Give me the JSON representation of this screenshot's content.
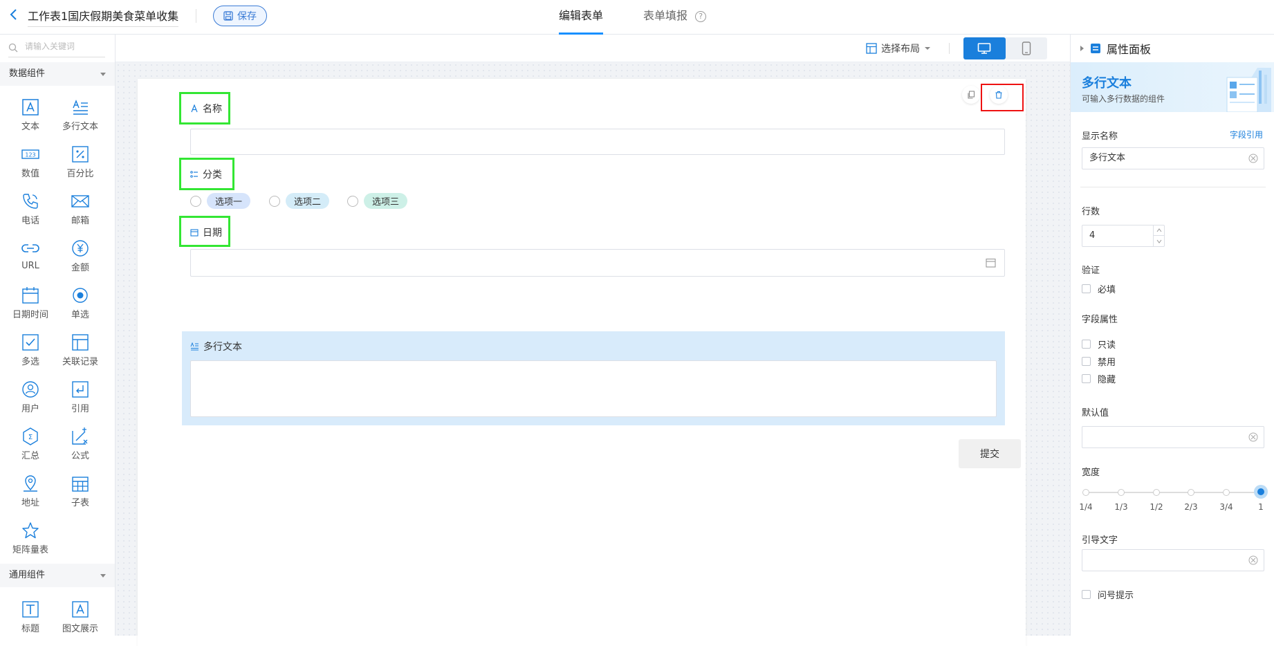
{
  "header": {
    "title": "工作表1国庆假期美食菜单收集",
    "save_label": "保存",
    "tabs": [
      {
        "label": "编辑表单",
        "active": true
      },
      {
        "label": "表单填报",
        "active": false
      }
    ],
    "help_icon": "question-circle-icon"
  },
  "sidebar": {
    "search_placeholder": "请输入关键词",
    "groups": [
      {
        "title": "数据组件",
        "items": [
          {
            "label": "文本",
            "icon": "text-icon"
          },
          {
            "label": "多行文本",
            "icon": "multiline-text-icon"
          },
          {
            "label": "数值",
            "icon": "number-icon"
          },
          {
            "label": "百分比",
            "icon": "percent-icon"
          },
          {
            "label": "电话",
            "icon": "phone-icon"
          },
          {
            "label": "邮箱",
            "icon": "mail-icon"
          },
          {
            "label": "URL",
            "icon": "link-icon"
          },
          {
            "label": "金额",
            "icon": "currency-icon"
          },
          {
            "label": "日期时间",
            "icon": "calendar-icon"
          },
          {
            "label": "单选",
            "icon": "radio-icon"
          },
          {
            "label": "多选",
            "icon": "checkbox-icon"
          },
          {
            "label": "关联记录",
            "icon": "relation-icon"
          },
          {
            "label": "用户",
            "icon": "user-icon"
          },
          {
            "label": "引用",
            "icon": "reference-icon"
          },
          {
            "label": "汇总",
            "icon": "sum-icon"
          },
          {
            "label": "公式",
            "icon": "formula-icon"
          },
          {
            "label": "地址",
            "icon": "location-icon"
          },
          {
            "label": "子表",
            "icon": "subtable-icon"
          },
          {
            "label": "矩阵量表",
            "icon": "star-icon"
          }
        ]
      },
      {
        "title": "通用组件",
        "items": [
          {
            "label": "标题",
            "icon": "heading-icon"
          },
          {
            "label": "图文展示",
            "icon": "rich-text-icon"
          }
        ]
      }
    ]
  },
  "toolbar": {
    "layout_label": "选择布局"
  },
  "form": {
    "fields": [
      {
        "label": "名称",
        "icon": "text-icon"
      },
      {
        "label": "分类",
        "icon": "list-icon"
      },
      {
        "label": "日期",
        "icon": "calendar-icon"
      },
      {
        "label": "多行文本",
        "icon": "multiline-text-icon"
      }
    ],
    "options": [
      {
        "label": "选项一",
        "color": "#d6e4fb"
      },
      {
        "label": "选项二",
        "color": "#d4ecf8"
      },
      {
        "label": "选项三",
        "color": "#cdf0e7"
      }
    ],
    "submit_label": "提交"
  },
  "panel": {
    "header": "属性面板",
    "component_title": "多行文本",
    "component_desc": "可输入多行数据的组件",
    "display_name_label": "显示名称",
    "field_ref_link": "字段引用",
    "display_name_value": "多行文本",
    "rows_label": "行数",
    "rows_value": "4",
    "validation_label": "验证",
    "required_label": "必填",
    "field_props_label": "字段属性",
    "readonly_label": "只读",
    "disabled_label": "禁用",
    "hidden_label": "隐藏",
    "default_label": "默认值",
    "width_label": "宽度",
    "width_options": [
      "1/4",
      "1/3",
      "1/2",
      "2/3",
      "3/4",
      "1"
    ],
    "width_selected": "1",
    "guide_label": "引导文字",
    "tooltip_label": "问号提示"
  },
  "colors": {
    "accent": "#1a7fdc",
    "highlight_green": "#33e633",
    "highlight_red": "#ee1111",
    "selected_bg": "#d8ebfb"
  }
}
